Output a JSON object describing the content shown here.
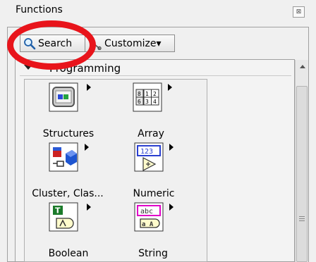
{
  "window": {
    "title": "Functions",
    "close_glyph": "⊠"
  },
  "toolbar": {
    "search_label": "Search",
    "search_icon": "magnifier-icon",
    "customize_label": "Customize▾",
    "customize_icon": "wrench-icon"
  },
  "highlight": {
    "color": "#e8141b",
    "target": "Search"
  },
  "palette": {
    "category": "Programming",
    "items": [
      {
        "label": "Structures",
        "icon": "structures-icon"
      },
      {
        "label": "Array",
        "icon": "array-icon"
      },
      {
        "label": "Cluster, Clas...",
        "icon": "cluster-icon"
      },
      {
        "label": "Numeric",
        "icon": "numeric-icon"
      },
      {
        "label": "Boolean",
        "icon": "boolean-icon"
      },
      {
        "label": "String",
        "icon": "string-icon"
      }
    ],
    "array_glyph_rows": [
      [
        "8",
        "1",
        "2"
      ],
      [
        "6",
        "3",
        "4"
      ]
    ],
    "numeric_glyph": "123",
    "boolean_glyph": "T",
    "string_glyph": "abc",
    "string_out_glyph": "a A"
  }
}
